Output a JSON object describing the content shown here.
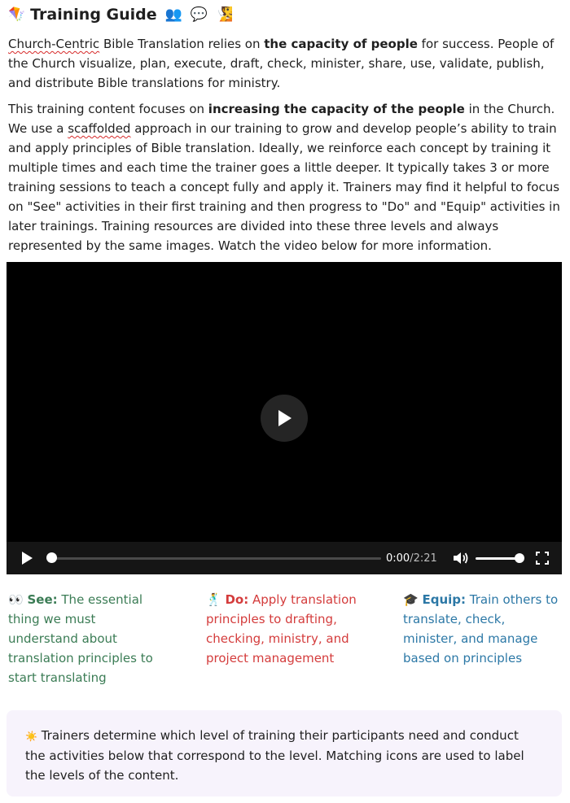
{
  "header": {
    "icon": "🪁",
    "title": "Training Guide",
    "trail_icons": [
      "👥",
      "💬",
      "🧏"
    ]
  },
  "intro": {
    "p1_link": "Church-Centric",
    "p1_a": " Bible Translation relies on ",
    "p1_bold": "the capacity of people",
    "p1_b": " for success. People of the Church visualize, plan, execute, draft, check, minister, share, use, validate, publish, and distribute Bible translations for ministry.",
    "p2_a": "This training content focuses on ",
    "p2_bold": "increasing the capacity of the people",
    "p2_b": " in the Church. We use a ",
    "p2_spell": "scaffolded",
    "p2_c": " approach in our training to grow and develop people’s ability to train and apply principles of Bible translation. Ideally, we reinforce each concept by training it multiple times and each time the trainer goes a little deeper. It typically takes 3 or more training sessions to teach a concept fully and apply it. Trainers may find it helpful to focus on \"See\" activities in their first training and then progress to \"Do\" and \"Equip\" activities in later trainings. Training resources are divided into these three levels and always represented by the same images. Watch the video below for more information."
  },
  "video": {
    "current_time": "0:00",
    "separator": " / ",
    "duration": "2:21",
    "progress": 0.0,
    "volume": 1.0
  },
  "levels": [
    {
      "icon": "👀",
      "label": "See:",
      "text": " The essential thing we must understand about translation principles to start translating",
      "color": "#3b7c55"
    },
    {
      "icon": "🕺",
      "label": "Do:",
      "text": " Apply translation principles to drafting, checking, ministry, and project management",
      "color": "#d43c3c"
    },
    {
      "icon": "🎓",
      "label": "Equip:",
      "text": " Train others to translate, check, minister, and manage based on principles",
      "color": "#2c78a6"
    }
  ],
  "callout": {
    "icon": "☀️",
    "text": " Trainers determine which level of training their participants need and conduct the activities below that correspond to the level. Matching icons are used to label the levels of the content."
  }
}
